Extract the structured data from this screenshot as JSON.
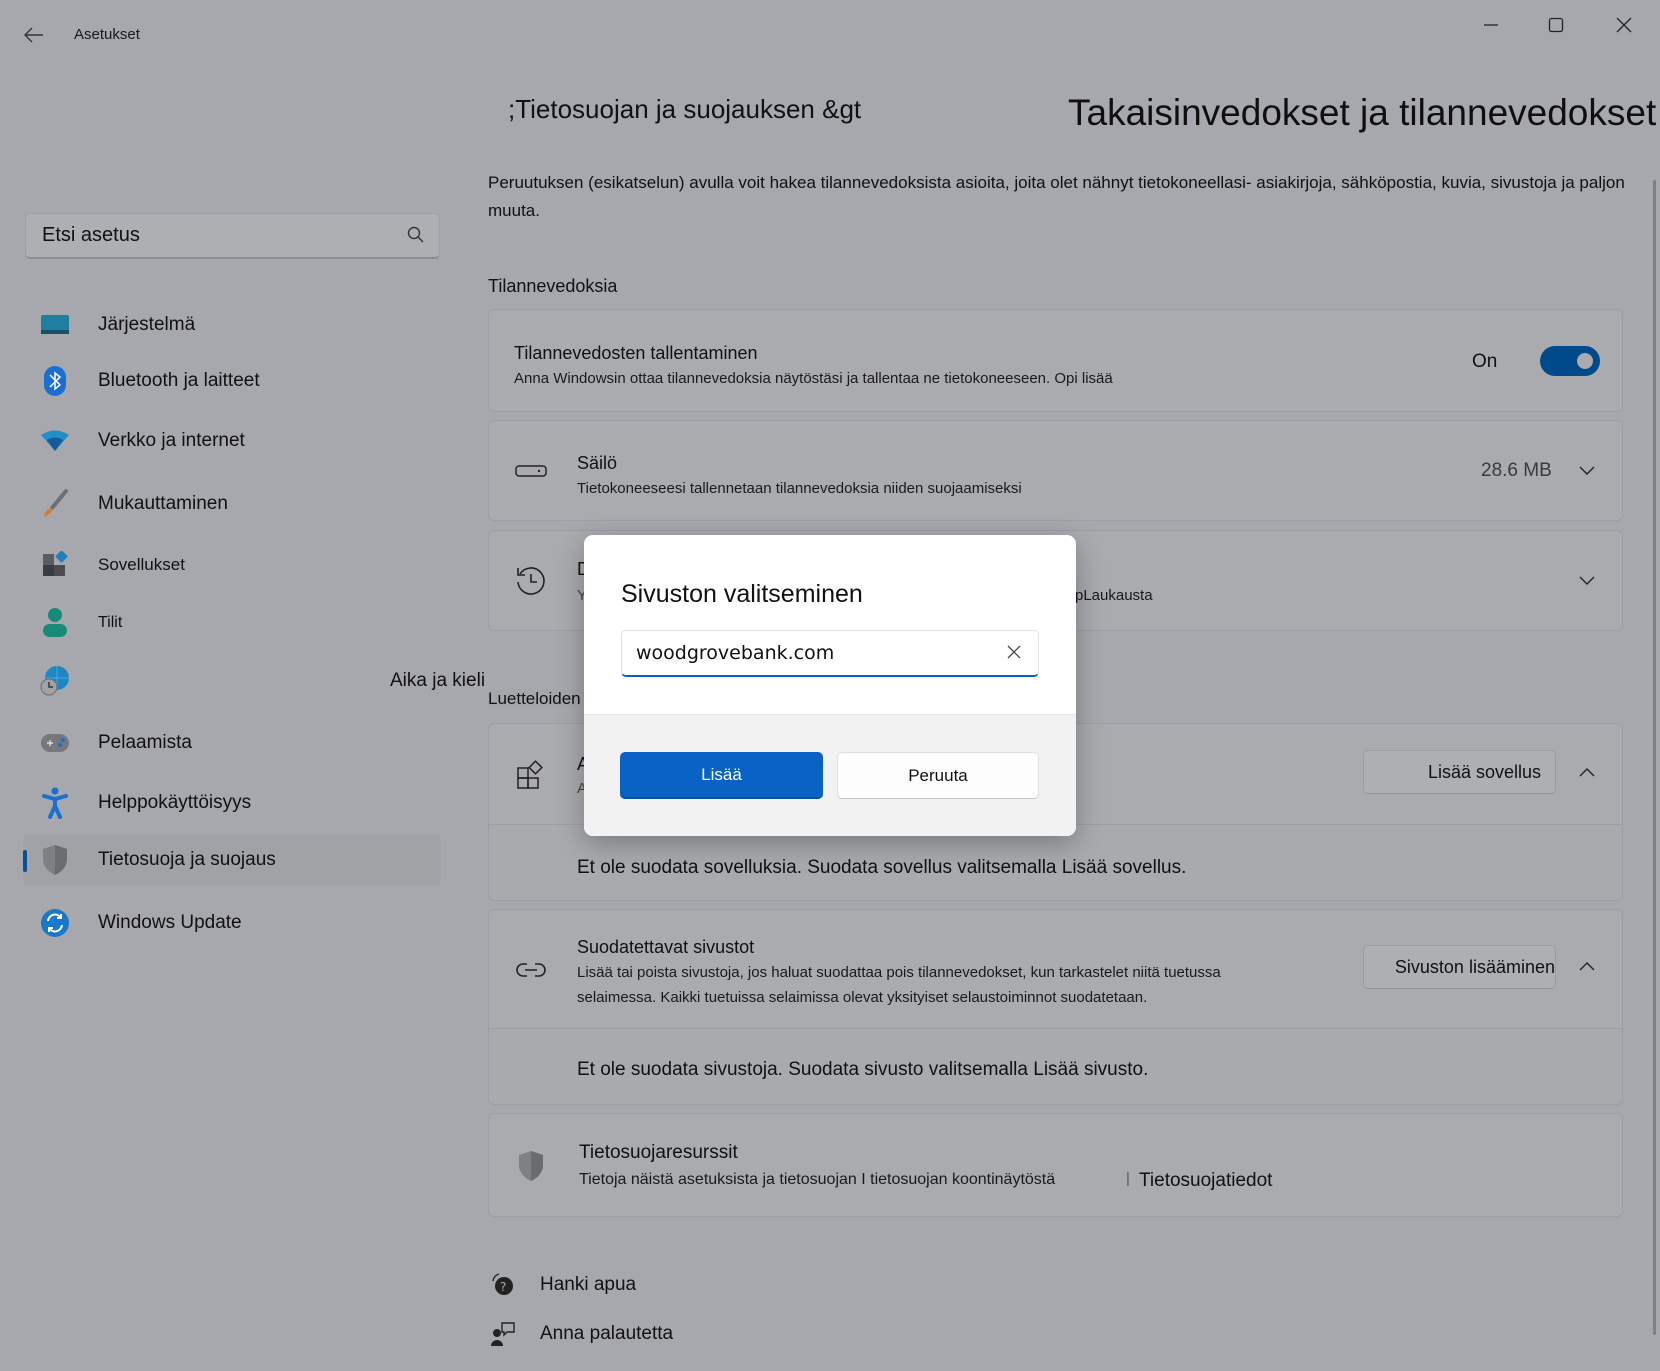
{
  "window": {
    "title": "Asetukset",
    "controls": {
      "minimize": "minimize-icon",
      "maximize": "maximize-icon",
      "close": "close-icon"
    }
  },
  "search": {
    "placeholder": "Etsi asetus",
    "icon": "search-icon"
  },
  "sidebar": {
    "items": [
      {
        "label": "Järjestelmä",
        "icon": "system-icon"
      },
      {
        "label": "Bluetooth ja laitteet",
        "icon": "bluetooth-icon"
      },
      {
        "label": "Verkko ja internet",
        "icon": "wifi-icon"
      },
      {
        "label": "Mukauttaminen",
        "icon": "paintbrush-icon"
      },
      {
        "label": "Sovellukset",
        "icon": "apps-icon"
      },
      {
        "label": "Tilit",
        "icon": "account-icon"
      },
      {
        "label": "",
        "icon": "time-language-icon"
      },
      {
        "label": "Pelaamista",
        "icon": "gamepad-icon"
      },
      {
        "label": "Helppokäyttöisyys",
        "icon": "accessibility-icon"
      },
      {
        "label": "Tietosuoja ja suojaus",
        "icon": "shield-icon",
        "active": true
      },
      {
        "label": "Windows Update",
        "icon": "windows-update-icon"
      }
    ],
    "floating_label": "Aika ja kieli"
  },
  "header": {
    "breadcrumb": ";Tietosuojan ja suojauksen &gt",
    "title": "Takaisinvedokset ja tilannevedokset",
    "description": "Peruutuksen (esikatselun) avulla voit hakea tilannevedoksista asioita, joita olet nähnyt tietokoneellasi- asiakirjoja, sähköpostia, kuvia, sivustoja ja paljon muuta."
  },
  "snapshots": {
    "section_label": "Tilannevedoksia",
    "save": {
      "title": "Tilannevedosten tallentaminen",
      "description": "Anna Windowsin ottaa tilannevedoksia näytöstäsi ja tallentaa ne tietokoneeseen. Opi lisää",
      "toggle_label": "On",
      "toggle_on": true
    },
    "storage": {
      "title": "Säilö",
      "description": "Tietokoneeseesi tallennetaan tilannevedoksia niiden suojaamiseksi",
      "value": "28.6 MB"
    },
    "history": {
      "title_visible": "D",
      "desc_visible_start": "Y",
      "desc_visible_end": "pLaukausta"
    }
  },
  "filters": {
    "section_label": "Luetteloiden suodattaminen",
    "apps": {
      "title_visible": "A",
      "desc_visible": "A",
      "button": "Lisää sovellus",
      "empty_text": "Et ole suodata sovelluksia. Suodata sovellus valitsemalla Lisää sovellus."
    },
    "sites": {
      "title": "Suodatettavat sivustot",
      "description": "Lisää tai poista sivustoja, jos haluat suodattaa pois tilannevedokset, kun tarkastelet niitä tuetussa selaimessa. Kaikki tuetuissa selaimissa olevat yksityiset selaustoiminnot suodatetaan.",
      "button": "Sivuston lisääminen",
      "empty_text": "Et ole suodata sivustoja. Suodata sivusto valitsemalla Lisää sivusto."
    }
  },
  "resources": {
    "title": "Tietosuojaresurssit",
    "links_text": "Tietoja näistä asetuksista ja tietosuojan I tietosuojan koontinäytöstä",
    "separator": "|",
    "privacy_link": "Tietosuojatiedot"
  },
  "footer": {
    "help": "Hanki apua",
    "feedback": "Anna palautetta"
  },
  "dialog": {
    "title": "Sivuston valitseminen",
    "input_value": "woodgrovebank.com",
    "primary": "Lisää",
    "secondary": "Peruuta"
  },
  "colors": {
    "accent": "#0963c4",
    "toggle": "#004a8c",
    "overlay_bg": "#a6a8ad"
  }
}
